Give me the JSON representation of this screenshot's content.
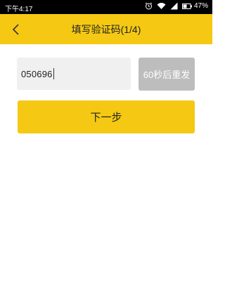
{
  "status_bar": {
    "time": "下午4:17",
    "battery": "47%",
    "icons": [
      "alarm-icon",
      "wifi-icon",
      "signal-icon",
      "battery-icon"
    ]
  },
  "header": {
    "title": "填写验证码(1/4)",
    "back_icon": "chevron-left-icon"
  },
  "form": {
    "code_value": "050696",
    "resend_label": "60秒后重发",
    "next_label": "下一步"
  },
  "colors": {
    "accent": "#f5c913",
    "resend_disabled": "#bdbdbd",
    "input_bg": "#f0f0f0"
  }
}
